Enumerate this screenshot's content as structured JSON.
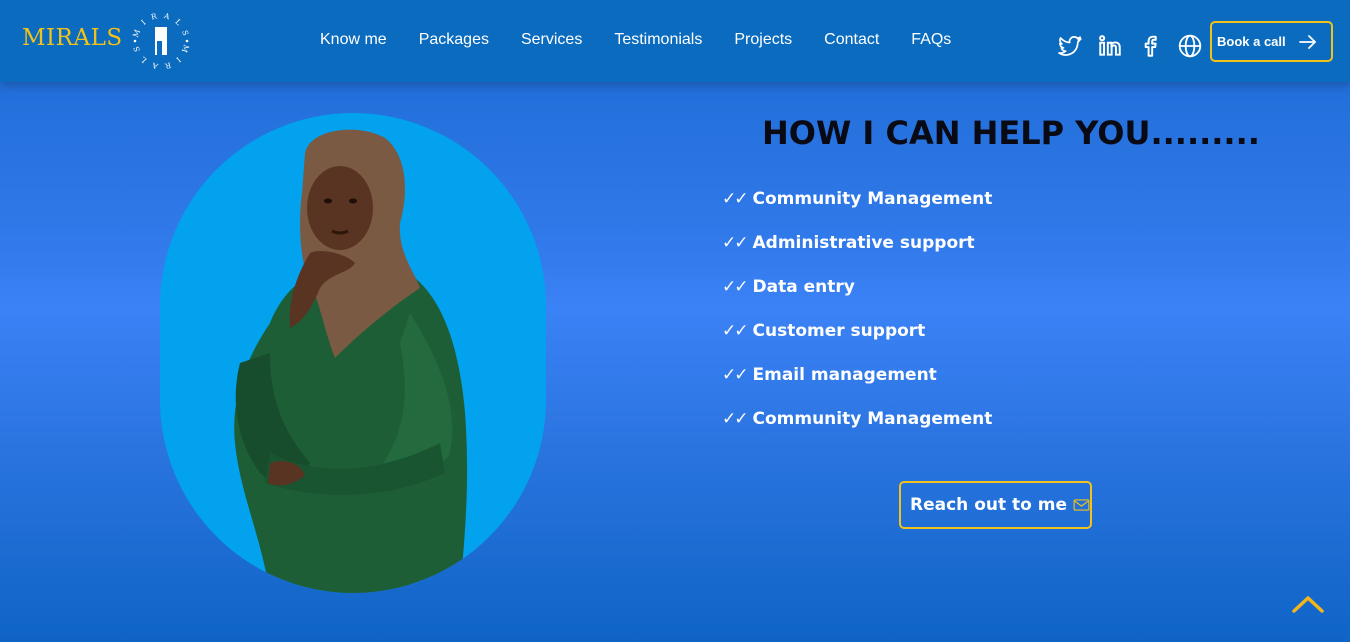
{
  "brand": {
    "name": "MIRALS",
    "seal_text": "M I R A L S",
    "accent_color": "#f2c21a",
    "nav_bg": "#0a6bbf"
  },
  "nav": {
    "links": [
      "Know me",
      "Packages",
      "Services",
      "Testimonials",
      "Projects",
      "Contact",
      "FAQs"
    ]
  },
  "social": {
    "icons": [
      "twitter-icon",
      "linkedin-icon",
      "facebook-icon",
      "globe-icon"
    ]
  },
  "cta": {
    "book_label": "Book a call",
    "book_icon": "arrow-right-icon"
  },
  "help": {
    "title": "HOW I CAN HELP YOU.........",
    "check_glyph": "✓✓",
    "items": [
      "Community Management",
      "Administrative support",
      "Data entry",
      "Customer support",
      "Email management",
      "Community Management"
    ],
    "reach_label": "Reach out to me",
    "reach_icon": "mail-icon"
  },
  "portrait": {
    "bg_color": "#02a2ee",
    "icon": "person-portrait"
  },
  "scroll_top": {
    "icon": "chevron-up-icon"
  }
}
